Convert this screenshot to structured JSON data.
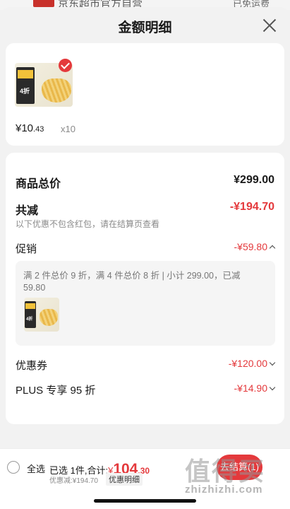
{
  "background_page": {
    "title_fragment": "京东超市官方自营",
    "shipping_fragment": "已免运费"
  },
  "sheet": {
    "title": "金额明细",
    "close_icon": "close-icon"
  },
  "product": {
    "price_int": "¥10",
    "price_dec": ".43",
    "quantity": "x10",
    "thumb_label": "4折",
    "selected_icon": "check-icon"
  },
  "summary": {
    "total_label": "商品总价",
    "total_value": "¥299.00",
    "discount_label": "共减",
    "discount_value": "-¥194.70",
    "note": "以下优惠不包含红包，请在结算页查看",
    "promo_label": "促销",
    "promo_value": "-¥59.80",
    "promo_detail": "满 2 件总价 9 折，满 4 件总价 8 折 | 小计 299.00，已减 59.80",
    "coupon_label": "优惠券",
    "coupon_value": "-¥120.00",
    "plus_label": "PLUS 专享 95 折",
    "plus_value": "-¥14.90"
  },
  "bottom_bar": {
    "select_all": "全选",
    "selected_text": "已选 1件,合计:",
    "currency": "¥",
    "amount_int": "104",
    "amount_dec": ".30",
    "discount_text": "优惠减:¥194.70",
    "detail_button": "优惠明细",
    "checkout_button": "去结算(1)"
  },
  "watermark": {
    "logo_text": "值得买",
    "url": "zhizhizhi.com"
  },
  "colors": {
    "accent": "#e4393c",
    "background": "#f2f2f2"
  }
}
